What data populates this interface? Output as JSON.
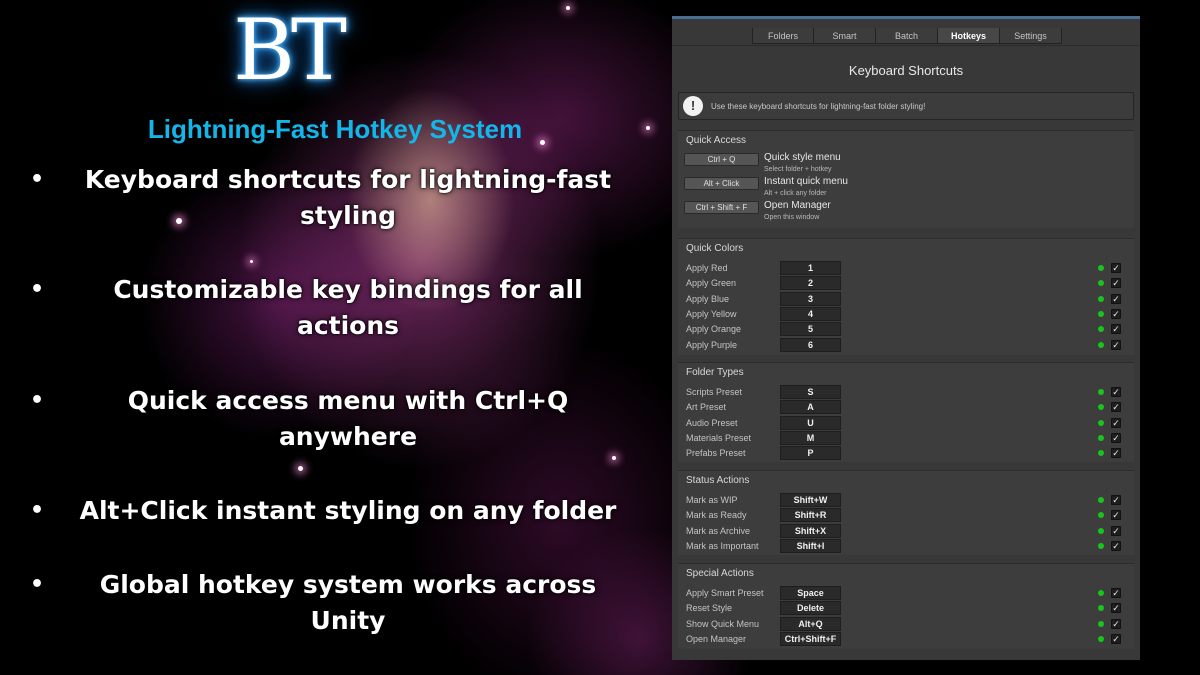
{
  "hero": {
    "logo": "BT",
    "headline": "Lightning-Fast Hotkey System",
    "bullets": [
      {
        "line1": "Keyboard shortcuts for lightning-fast",
        "line2": "styling"
      },
      {
        "line1": "Customizable key bindings for all",
        "line2": "actions"
      },
      {
        "line1": "Quick access menu with Ctrl+Q",
        "line2": "anywhere"
      },
      {
        "line1": "Alt+Click instant styling on any folder",
        "line2": ""
      },
      {
        "line1": "Global hotkey system works across",
        "line2": "Unity"
      }
    ],
    "bullet_glyph": "•"
  },
  "panel": {
    "tabs": [
      {
        "label": "Folders",
        "active": false
      },
      {
        "label": "Smart",
        "active": false
      },
      {
        "label": "Batch",
        "active": false
      },
      {
        "label": "Hotkeys",
        "active": true
      },
      {
        "label": "Settings",
        "active": false
      }
    ],
    "title": "Keyboard Shortcuts",
    "help": {
      "icon": "info-exclamation-icon",
      "icon_glyph": "!",
      "text": "Use these keyboard shortcuts for lightning-fast folder styling!"
    },
    "quick_access": {
      "heading": "Quick Access",
      "items": [
        {
          "key": "Ctrl + Q",
          "title": "Quick style menu",
          "desc": "Select folder + hotkey"
        },
        {
          "key": "Alt + Click",
          "title": "Instant quick menu",
          "desc": "Alt + click any folder"
        },
        {
          "key": "Ctrl + Shift + F",
          "title": "Open Manager",
          "desc": "Open this window"
        }
      ]
    },
    "sections": [
      {
        "heading": "Quick Colors",
        "rows": [
          {
            "label": "Apply Red",
            "key": "1",
            "enabled": true
          },
          {
            "label": "Apply Green",
            "key": "2",
            "enabled": true
          },
          {
            "label": "Apply Blue",
            "key": "3",
            "enabled": true
          },
          {
            "label": "Apply Yellow",
            "key": "4",
            "enabled": true
          },
          {
            "label": "Apply Orange",
            "key": "5",
            "enabled": true
          },
          {
            "label": "Apply Purple",
            "key": "6",
            "enabled": true
          }
        ]
      },
      {
        "heading": "Folder Types",
        "rows": [
          {
            "label": "Scripts Preset",
            "key": "S",
            "enabled": true
          },
          {
            "label": "Art Preset",
            "key": "A",
            "enabled": true
          },
          {
            "label": "Audio Preset",
            "key": "U",
            "enabled": true
          },
          {
            "label": "Materials Preset",
            "key": "M",
            "enabled": true
          },
          {
            "label": "Prefabs Preset",
            "key": "P",
            "enabled": true
          }
        ]
      },
      {
        "heading": "Status Actions",
        "rows": [
          {
            "label": "Mark as WIP",
            "key": "Shift+W",
            "enabled": true
          },
          {
            "label": "Mark as Ready",
            "key": "Shift+R",
            "enabled": true
          },
          {
            "label": "Mark as Archive",
            "key": "Shift+X",
            "enabled": true
          },
          {
            "label": "Mark as Important",
            "key": "Shift+I",
            "enabled": true
          }
        ]
      },
      {
        "heading": "Special Actions",
        "rows": [
          {
            "label": "Apply Smart Preset",
            "key": "Space",
            "enabled": true
          },
          {
            "label": "Reset Style",
            "key": "Delete",
            "enabled": true
          },
          {
            "label": "Show Quick Menu",
            "key": "Alt+Q",
            "enabled": true
          },
          {
            "label": "Open Manager",
            "key": "Ctrl+Shift+F",
            "enabled": true
          }
        ]
      }
    ],
    "checkmark_glyph": "✓",
    "colors": {
      "active_led": "#19c51c",
      "accent_bar": "#4a6e92",
      "headline": "#12b6e8",
      "logo_glow": "#1e88ff"
    }
  }
}
